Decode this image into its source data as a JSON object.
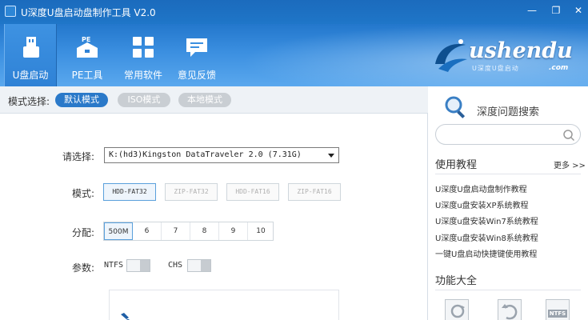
{
  "titlebar": {
    "title": "U深度U盘启动盘制作工具 V2.0",
    "min": "—",
    "max": "❐",
    "close": "✕"
  },
  "nav": {
    "items": [
      {
        "label": "U盘启动",
        "icon": "usb-drive-icon",
        "active": true
      },
      {
        "label": "PE工具",
        "icon": "pe-toolbox-icon",
        "active": false
      },
      {
        "label": "常用软件",
        "icon": "apps-grid-icon",
        "active": false
      },
      {
        "label": "意见反馈",
        "icon": "feedback-chat-icon",
        "active": false
      }
    ]
  },
  "logo": {
    "text": "ushendu",
    "sub": "U深度U盘启动",
    "com": ".com"
  },
  "mode": {
    "label": "模式选择:",
    "options": [
      "默认模式",
      "ISO模式",
      "本地模式"
    ],
    "selected": "默认模式"
  },
  "form": {
    "drive_label": "请选择:",
    "drive_value": "K:(hd3)Kingston DataTraveler 2.0 (7.31G)",
    "format_label": "模式:",
    "formats": [
      "HDD-FAT32",
      "ZIP-FAT32",
      "HDD-FAT16",
      "ZIP-FAT16"
    ],
    "format_selected": "HDD-FAT32",
    "partition_label": "分配:",
    "partitions": [
      "500M",
      "6",
      "7",
      "8",
      "9",
      "10"
    ],
    "partition_selected": "500M",
    "params_label": "参数:",
    "ntfs_label": "NTFS",
    "chs_label": "CHS"
  },
  "side": {
    "search_title": "深度问题搜索",
    "search_placeholder": "",
    "tutorials_title": "使用教程",
    "more": "更多 >>",
    "tutorials": [
      "U深度U盘启动盘制作教程",
      "U深度u盘安装XP系统教程",
      "U深度u盘安装Win7系统教程",
      "U深度u盘安装Win8系统教程",
      "一键U盘启动快捷键使用教程"
    ],
    "features_title": "功能大全",
    "tools": [
      {
        "icon": "refresh-drive-icon"
      },
      {
        "icon": "restore-drive-icon"
      },
      {
        "label": "NTFS",
        "icon": "ntfs-icon"
      }
    ]
  },
  "colors": {
    "accent": "#2a79c9",
    "header_top": "#2377cc",
    "header_bottom": "#5aa8ee"
  }
}
